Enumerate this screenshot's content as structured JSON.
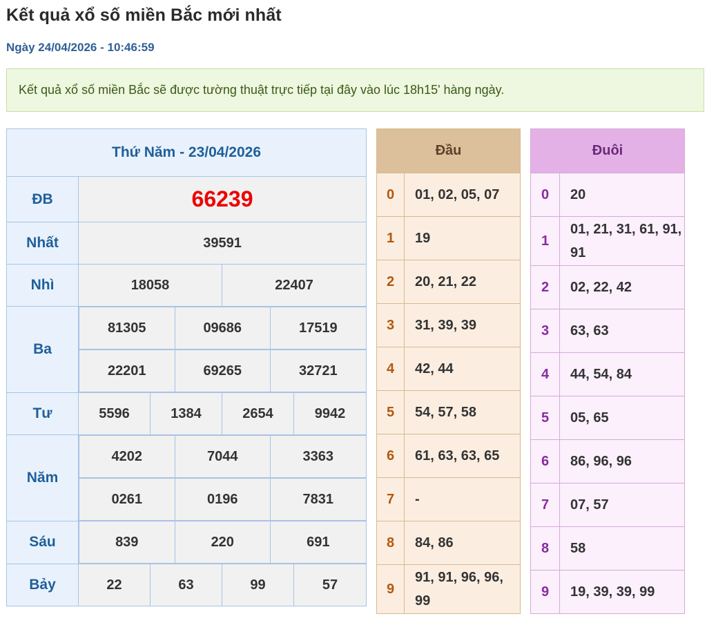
{
  "page": {
    "title": "Kết quả xổ số miền Bắc mới nhất",
    "date": "Ngày 24/04/2026 - 10:46:59",
    "notice": "Kết quả xổ số miền Bắc sẽ được tường thuật trực tiếp tại đây vào lúc 18h15' hàng ngày."
  },
  "results": {
    "heading": "Thứ Năm - 23/04/2026",
    "db_label": "ĐB",
    "db": "66239",
    "nhat_label": "Nhất",
    "nhat": "39591",
    "nhi_label": "Nhì",
    "nhi": [
      "18058",
      "22407"
    ],
    "ba_label": "Ba",
    "ba": [
      "81305",
      "09686",
      "17519",
      "22201",
      "69265",
      "32721"
    ],
    "tu_label": "Tư",
    "tu": [
      "5596",
      "1384",
      "2654",
      "9942"
    ],
    "nam_label": "Năm",
    "nam": [
      "4202",
      "7044",
      "3363",
      "0261",
      "0196",
      "7831"
    ],
    "sau_label": "Sáu",
    "sau": [
      "839",
      "220",
      "691"
    ],
    "bay_label": "Bảy",
    "bay": [
      "22",
      "63",
      "99",
      "57"
    ]
  },
  "dau": {
    "heading": "Đầu",
    "rows": [
      {
        "digit": "0",
        "values": "01, 02, 05, 07"
      },
      {
        "digit": "1",
        "values": "19"
      },
      {
        "digit": "2",
        "values": "20, 21, 22"
      },
      {
        "digit": "3",
        "values": "31, 39, 39"
      },
      {
        "digit": "4",
        "values": "42, 44"
      },
      {
        "digit": "5",
        "values": "54, 57, 58"
      },
      {
        "digit": "6",
        "values": "61, 63, 63, 65"
      },
      {
        "digit": "7",
        "values": "-"
      },
      {
        "digit": "8",
        "values": "84, 86"
      },
      {
        "digit": "9",
        "values": "91, 91, 96, 96, 99"
      }
    ]
  },
  "duoi": {
    "heading": "Đuôi",
    "rows": [
      {
        "digit": "0",
        "values": "20"
      },
      {
        "digit": "1",
        "values": "01, 21, 31, 61, 91, 91"
      },
      {
        "digit": "2",
        "values": "02, 22, 42"
      },
      {
        "digit": "3",
        "values": "63, 63"
      },
      {
        "digit": "4",
        "values": "44, 54, 84"
      },
      {
        "digit": "5",
        "values": "05, 65"
      },
      {
        "digit": "6",
        "values": "86, 96, 96"
      },
      {
        "digit": "7",
        "values": "07, 57"
      },
      {
        "digit": "8",
        "values": "58"
      },
      {
        "digit": "9",
        "values": "19, 39, 39, 99"
      }
    ]
  }
}
